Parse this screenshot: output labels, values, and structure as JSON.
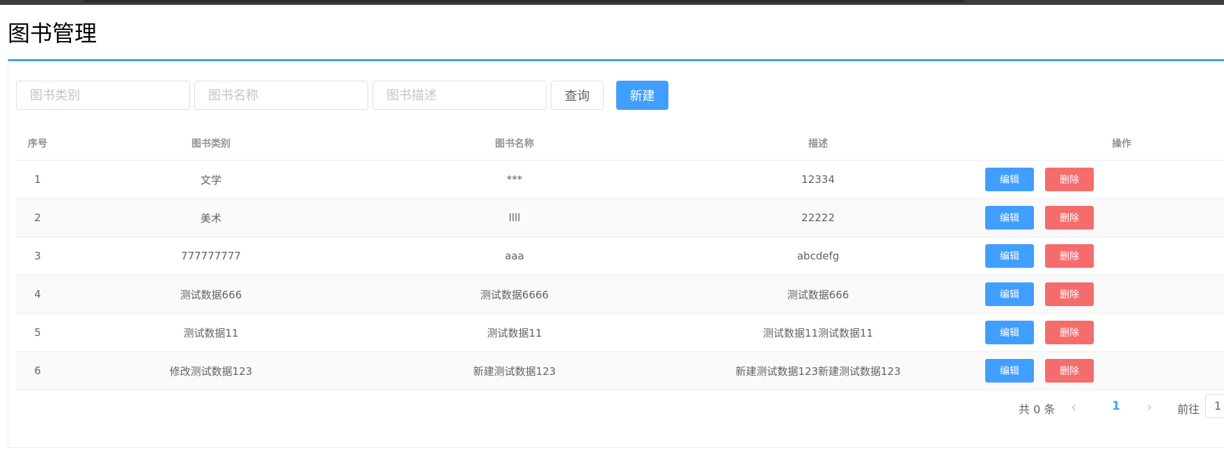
{
  "page": {
    "title": "图书管理"
  },
  "search": {
    "category_placeholder": "图书类别",
    "name_placeholder": "图书名称",
    "desc_placeholder": "图书描述",
    "query_label": "查询",
    "create_label": "新建"
  },
  "table": {
    "headers": [
      "序号",
      "图书类别",
      "图书名称",
      "描述",
      "操作"
    ],
    "rows": [
      {
        "index": "1",
        "category": "文学",
        "name": "***",
        "desc": "12334",
        "edit": "编辑",
        "delete": "删除"
      },
      {
        "index": "2",
        "category": "美术",
        "name": "llll",
        "desc": "22222",
        "edit": "编辑",
        "delete": "删除"
      },
      {
        "index": "3",
        "category": "777777777",
        "name": "aaa",
        "desc": "abcdefg",
        "edit": "编辑",
        "delete": "删除"
      },
      {
        "index": "4",
        "category": "测试数据666",
        "name": "测试数据6666",
        "desc": "测试数据666",
        "edit": "编辑",
        "delete": "删除"
      },
      {
        "index": "5",
        "category": "测试数据11",
        "name": "测试数据11",
        "desc": "测试数据11测试数据11",
        "edit": "编辑",
        "delete": "删除"
      },
      {
        "index": "6",
        "category": "修改测试数据123",
        "name": "新建测试数据123",
        "desc": "新建测试数据123新建测试数据123",
        "edit": "编辑",
        "delete": "删除"
      }
    ]
  },
  "pagination": {
    "total": "共 0 条",
    "prev_icon": "‹",
    "current_page": "1",
    "next_icon": "›",
    "goto_label": "前往",
    "goto_value": "1"
  },
  "colors": {
    "primary": "#409eff",
    "danger": "#f56c6c",
    "border": "#ebeef5"
  }
}
